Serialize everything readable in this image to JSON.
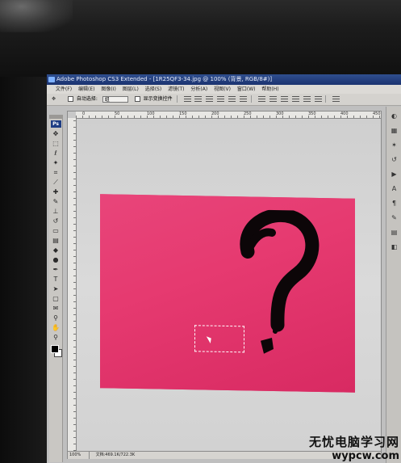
{
  "window": {
    "title": "Adobe Photoshop CS3 Extended - [1R25QF3-34.jpg @ 100% (背景, RGB/8#)]"
  },
  "menu": [
    "文件(F)",
    "编辑(E)",
    "图像(I)",
    "图层(L)",
    "选择(S)",
    "滤镜(T)",
    "分析(A)",
    "视图(V)",
    "窗口(W)",
    "帮助(H)"
  ],
  "options_bar": {
    "tool_glyph": "✥",
    "auto_select_label": "自动选择:",
    "auto_select_value": "组",
    "show_transform_label": "显示变换控件"
  },
  "toolbox": {
    "logo": "Ps",
    "tools": [
      {
        "name": "move-tool-icon",
        "glyph": "✥"
      },
      {
        "name": "marquee-tool-icon",
        "glyph": "⬚"
      },
      {
        "name": "lasso-tool-icon",
        "glyph": "ℓ"
      },
      {
        "name": "magic-wand-tool-icon",
        "glyph": "✦"
      },
      {
        "name": "crop-tool-icon",
        "glyph": "⌗"
      },
      {
        "name": "slice-tool-icon",
        "glyph": "⟋"
      },
      {
        "name": "healing-brush-tool-icon",
        "glyph": "✚"
      },
      {
        "name": "brush-tool-icon",
        "glyph": "✎"
      },
      {
        "name": "clone-stamp-tool-icon",
        "glyph": "⊥"
      },
      {
        "name": "history-brush-tool-icon",
        "glyph": "↺"
      },
      {
        "name": "eraser-tool-icon",
        "glyph": "▭"
      },
      {
        "name": "gradient-tool-icon",
        "glyph": "▤"
      },
      {
        "name": "blur-tool-icon",
        "glyph": "◆"
      },
      {
        "name": "dodge-tool-icon",
        "glyph": "●"
      },
      {
        "name": "pen-tool-icon",
        "glyph": "✒"
      },
      {
        "name": "type-tool-icon",
        "glyph": "T"
      },
      {
        "name": "path-selection-tool-icon",
        "glyph": "➤"
      },
      {
        "name": "shape-tool-icon",
        "glyph": "▢"
      },
      {
        "name": "notes-tool-icon",
        "glyph": "✉"
      },
      {
        "name": "eyedropper-tool-icon",
        "glyph": "⚲"
      },
      {
        "name": "hand-tool-icon",
        "glyph": "✋"
      },
      {
        "name": "zoom-tool-icon",
        "glyph": "⚲"
      }
    ]
  },
  "ruler": {
    "h_labels": [
      "0",
      "50",
      "100",
      "150",
      "200",
      "250",
      "300",
      "350",
      "400",
      "450"
    ]
  },
  "canvas": {
    "background_color": "#e63a70",
    "artwork": "question-mark"
  },
  "status": {
    "zoom": "100%",
    "doc_info": "文档:469.1K/722.3K"
  },
  "panels": [
    {
      "name": "color-panel-icon",
      "glyph": "◐"
    },
    {
      "name": "swatches-panel-icon",
      "glyph": "▦"
    },
    {
      "name": "styles-panel-icon",
      "glyph": "✶"
    },
    {
      "name": "history-panel-icon",
      "glyph": "↺"
    },
    {
      "name": "actions-panel-icon",
      "glyph": "▶"
    },
    {
      "name": "character-panel-icon",
      "glyph": "A"
    },
    {
      "name": "paragraph-panel-icon",
      "glyph": "¶"
    },
    {
      "name": "brushes-panel-icon",
      "glyph": "✎"
    },
    {
      "name": "layers-panel-icon",
      "glyph": "▤"
    },
    {
      "name": "channels-panel-icon",
      "glyph": "◧"
    }
  ],
  "watermark": {
    "cn": "无忧电脑学习网",
    "url": "wypcw.com"
  }
}
